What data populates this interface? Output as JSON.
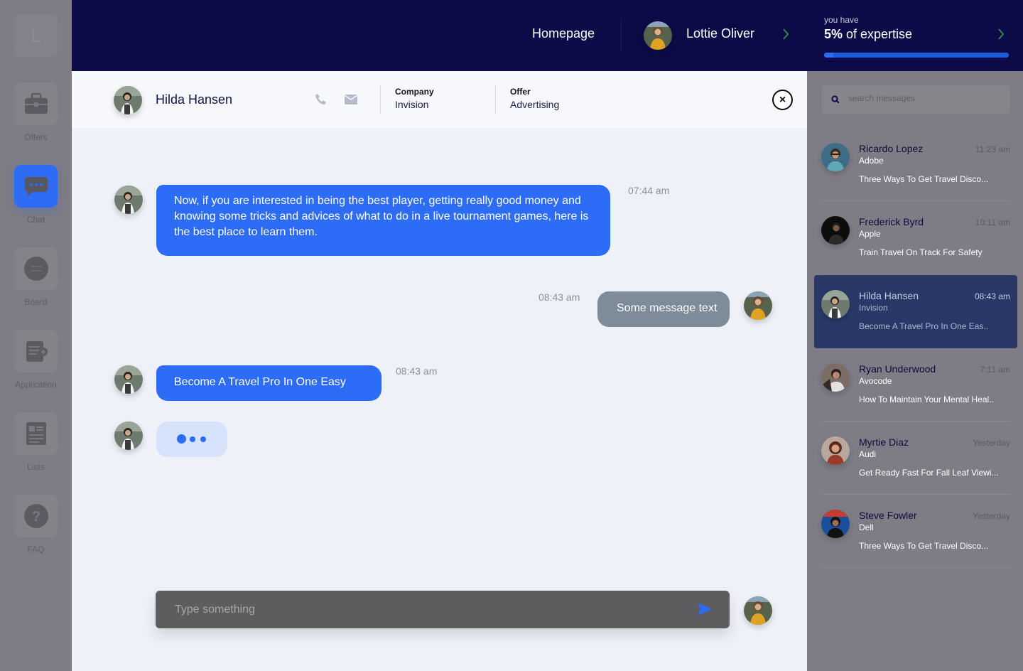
{
  "sidebar": {
    "logo_letter": "L",
    "items": [
      {
        "label": "Offers",
        "icon": "briefcase-icon"
      },
      {
        "label": "Chat",
        "icon": "chat-icon",
        "active": true
      },
      {
        "label": "Board",
        "icon": "board-icon"
      },
      {
        "label": "Application",
        "icon": "application-icon"
      },
      {
        "label": "Lists",
        "icon": "lists-icon"
      },
      {
        "label": "FAQ",
        "icon": "question-icon"
      }
    ]
  },
  "topbar": {
    "home_label": "Homepage",
    "user_name": "Lottie Oliver",
    "expertise_small": "you have",
    "expertise_percent": "5%",
    "expertise_suffix": " of expertise",
    "expertise_progress": 0.05
  },
  "chat": {
    "contact_name": "Hilda Hansen",
    "company_label": "Company",
    "company_value": "Invision",
    "offer_label": "Offer",
    "offer_value": "Advertising",
    "close_label": "×",
    "messages": [
      {
        "text": "Now, if you are interested in being the best player, getting really good money and knowing some tricks and advices of what to do in a live tournament games, here is the best place to learn them.",
        "time": "07:44 am"
      },
      {
        "text": "Some message text",
        "time": "08:43 am"
      },
      {
        "text": "Become A Travel Pro In One Easy",
        "time": "08:43 am"
      }
    ],
    "composer_placeholder": "Type something"
  },
  "panel": {
    "search_placeholder": "search messages",
    "conversations": [
      {
        "name": "Ricardo Lopez",
        "org": "Adobe",
        "time": "11:23 am",
        "preview": "Three Ways To Get Travel Disco..."
      },
      {
        "name": "Frederick Byrd",
        "org": "Apple",
        "time": "10:11 am",
        "preview": "Train Travel On Track For Safety"
      },
      {
        "name": "Hilda Hansen",
        "org": "Invision",
        "time": "08:43 am",
        "preview": "Become A Travel Pro In One Eas.."
      },
      {
        "name": "Ryan Underwood",
        "org": "Avocode",
        "time": "7:11 am",
        "preview": "How To Maintain Your Mental Heal.."
      },
      {
        "name": "Myrtie Diaz",
        "org": "Audi",
        "time": "Yesterday",
        "preview": "Get Ready Fast For Fall Leaf Viewi..."
      },
      {
        "name": "Steve Fowler",
        "org": "Dell",
        "time": "Yesterday",
        "preview": "Three Ways To Get Travel Disco..."
      }
    ]
  },
  "colors": {
    "navy": "#0c0b47",
    "accent_blue": "#2d6cf6",
    "selected_conv": "#2a3868",
    "overlay_gray": "#7e7c85"
  }
}
